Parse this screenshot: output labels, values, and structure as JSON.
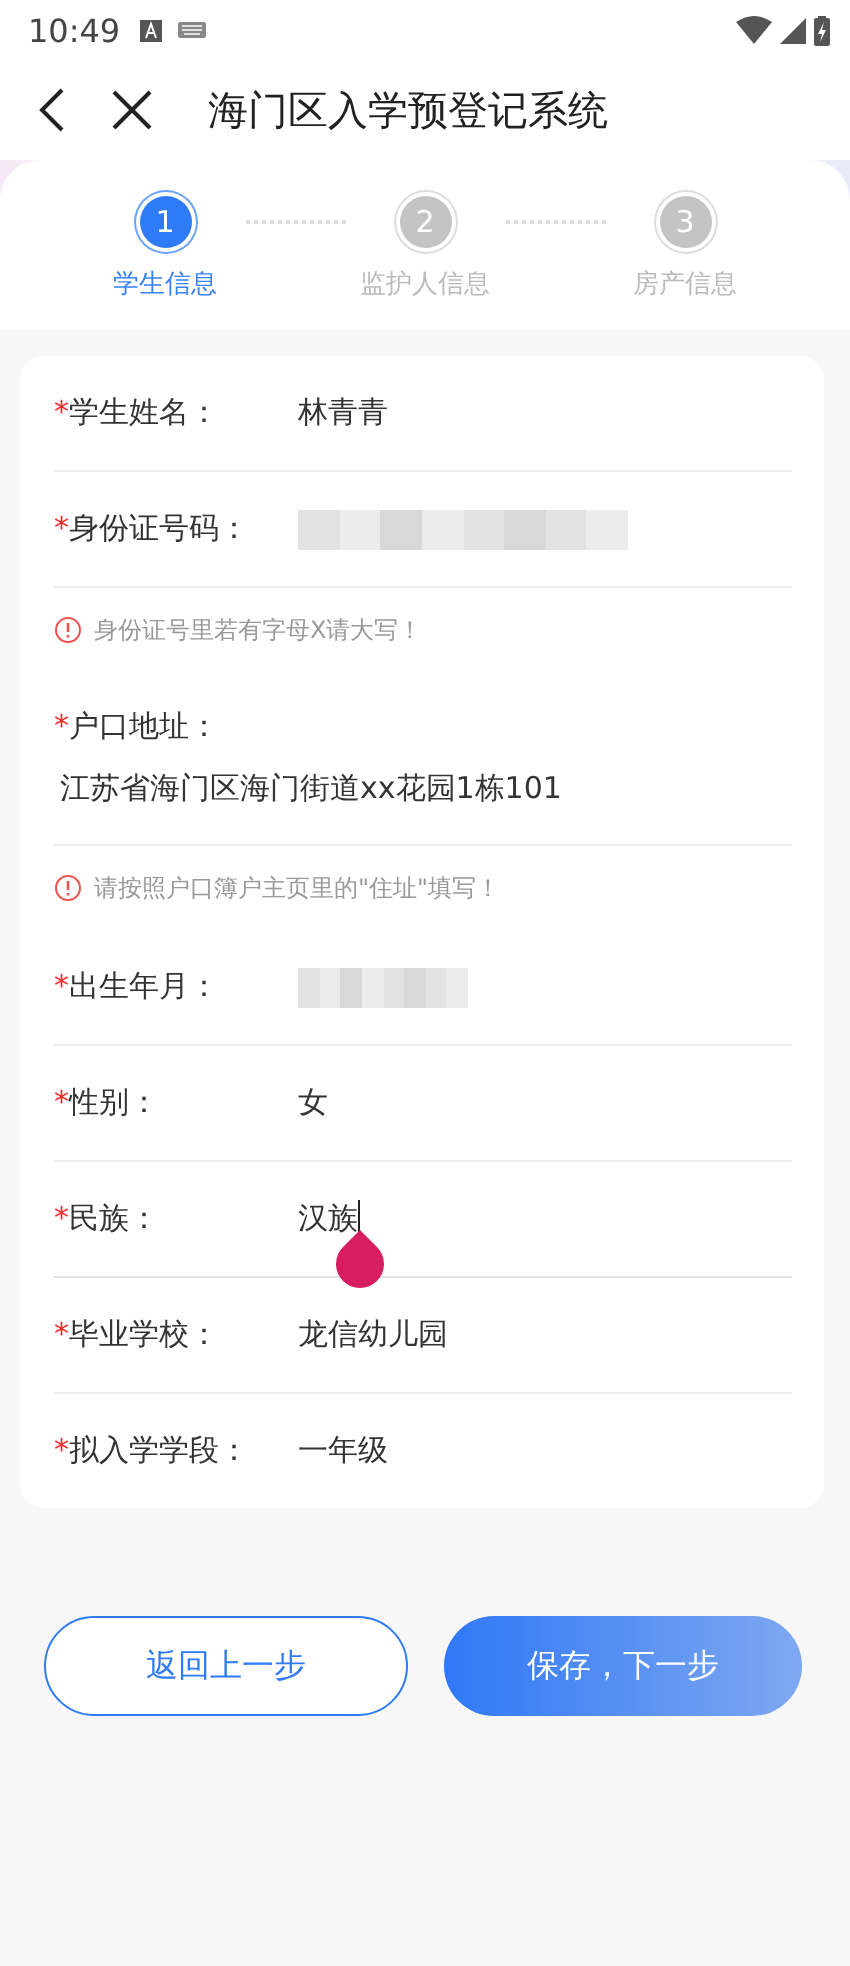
{
  "status_bar": {
    "time": "10:49"
  },
  "nav_bar": {
    "title": "海门区入学预登记系统"
  },
  "steps": [
    {
      "number": "1",
      "label": "学生信息",
      "selected": true
    },
    {
      "number": "2",
      "label": "监护人信息",
      "selected": false
    },
    {
      "number": "3",
      "label": "房产信息",
      "selected": false
    }
  ],
  "form": {
    "fields": [
      {
        "kind": "inline",
        "mark": "*",
        "label": "学生姓名：",
        "value": "林青青",
        "redacted": false,
        "focused": false
      },
      {
        "kind": "inline",
        "mark": "*",
        "label": "身份证号码：",
        "redacted": true,
        "focused": false,
        "hint": "身份证号里若有字母X请大写！"
      },
      {
        "kind": "stacked",
        "mark": "*",
        "label": "户口地址：",
        "value": "江苏省海门区海门街道xx花园1栋101",
        "redacted": false,
        "focused": false,
        "hint": "请按照户口簿户主页里的\"住址\"填写！"
      },
      {
        "kind": "inline",
        "mark": "*",
        "label": "出生年月：",
        "redacted": true,
        "focused": false
      },
      {
        "kind": "inline",
        "mark": "*",
        "label": "性别：",
        "value": "女",
        "redacted": false,
        "focused": false
      },
      {
        "kind": "inline",
        "mark": "*",
        "label": "民族：",
        "value": "汉族",
        "redacted": false,
        "focused": true
      },
      {
        "kind": "inline",
        "mark": "*",
        "label": "毕业学校：",
        "value": "龙信幼儿园",
        "redacted": false,
        "focused": false
      },
      {
        "kind": "inline",
        "mark": "*",
        "label": "拟入学学段：",
        "value": "一年级",
        "redacted": false,
        "focused": false
      }
    ]
  },
  "buttons": [
    {
      "kind": "secondary",
      "label": "返回上一步"
    },
    {
      "kind": "primary",
      "label": "保存，下一步"
    }
  ]
}
